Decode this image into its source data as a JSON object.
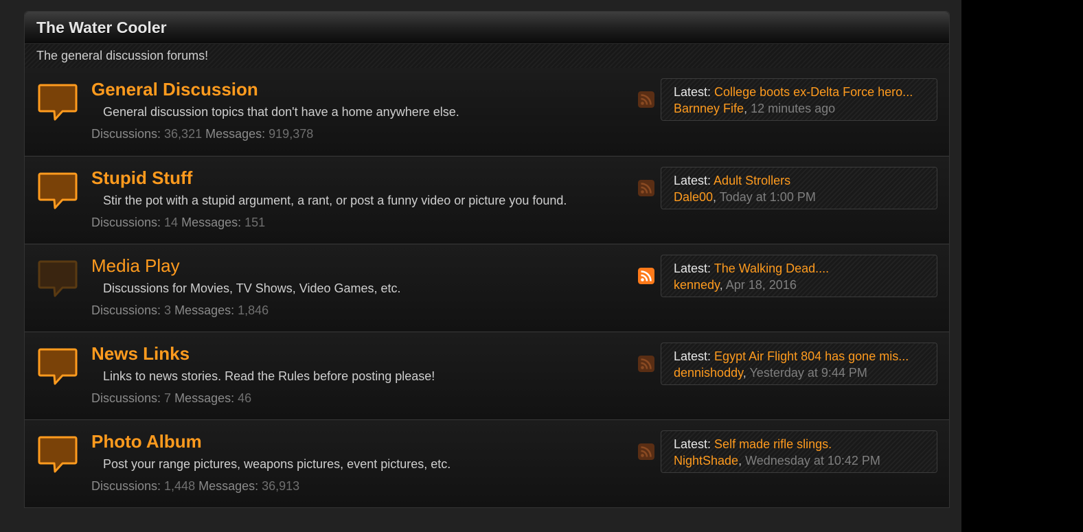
{
  "category": {
    "title": "The Water Cooler",
    "description": "The general discussion forums!"
  },
  "labels": {
    "discussions": "Discussions:",
    "messages": "Messages:",
    "latest": "Latest:",
    "separator": ","
  },
  "colors": {
    "accent": "#ff9b1e",
    "rss_active": "#ff7a1a",
    "rss_inactive": "#5a2e14"
  },
  "forums": [
    {
      "title": "General Discussion",
      "description": "General discussion topics that don't have a home anywhere else.",
      "discussions": "36,321",
      "messages": "919,378",
      "latest_thread": "College boots ex-Delta Force hero...",
      "latest_user": "Barnney Fife",
      "latest_time": "12 minutes ago",
      "unread": true,
      "icon": "speech-bubble-icon",
      "rss_icon": "rss-feed-icon"
    },
    {
      "title": "Stupid Stuff",
      "description": "Stir the pot with a stupid argument, a rant, or post a funny video or picture you found.",
      "discussions": "14",
      "messages": "151",
      "latest_thread": "Adult Strollers",
      "latest_user": "Dale00",
      "latest_time": "Today at 1:00 PM",
      "unread": true,
      "icon": "speech-bubble-icon",
      "rss_icon": "rss-feed-icon"
    },
    {
      "title": "Media Play",
      "description": "Discussions for Movies, TV Shows, Video Games, etc.",
      "discussions": "3",
      "messages": "1,846",
      "latest_thread": "The Walking Dead....",
      "latest_user": "kennedy",
      "latest_time": "Apr 18, 2016",
      "unread": false,
      "icon": "speech-bubble-icon",
      "rss_icon": "rss-feed-icon"
    },
    {
      "title": "News Links",
      "description": "Links to news stories. Read the Rules before posting please!",
      "discussions": "7",
      "messages": "46",
      "latest_thread": "Egypt Air Flight 804 has gone mis...",
      "latest_user": "dennishoddy",
      "latest_time": "Yesterday at 9:44 PM",
      "unread": true,
      "icon": "speech-bubble-icon",
      "rss_icon": "rss-feed-icon"
    },
    {
      "title": "Photo Album",
      "description": "Post your range pictures, weapons pictures, event pictures, etc.",
      "discussions": "1,448",
      "messages": "36,913",
      "latest_thread": "Self made rifle slings.",
      "latest_user": "NightShade",
      "latest_time": "Wednesday at 10:42 PM",
      "unread": true,
      "icon": "speech-bubble-icon",
      "rss_icon": "rss-feed-icon"
    }
  ]
}
